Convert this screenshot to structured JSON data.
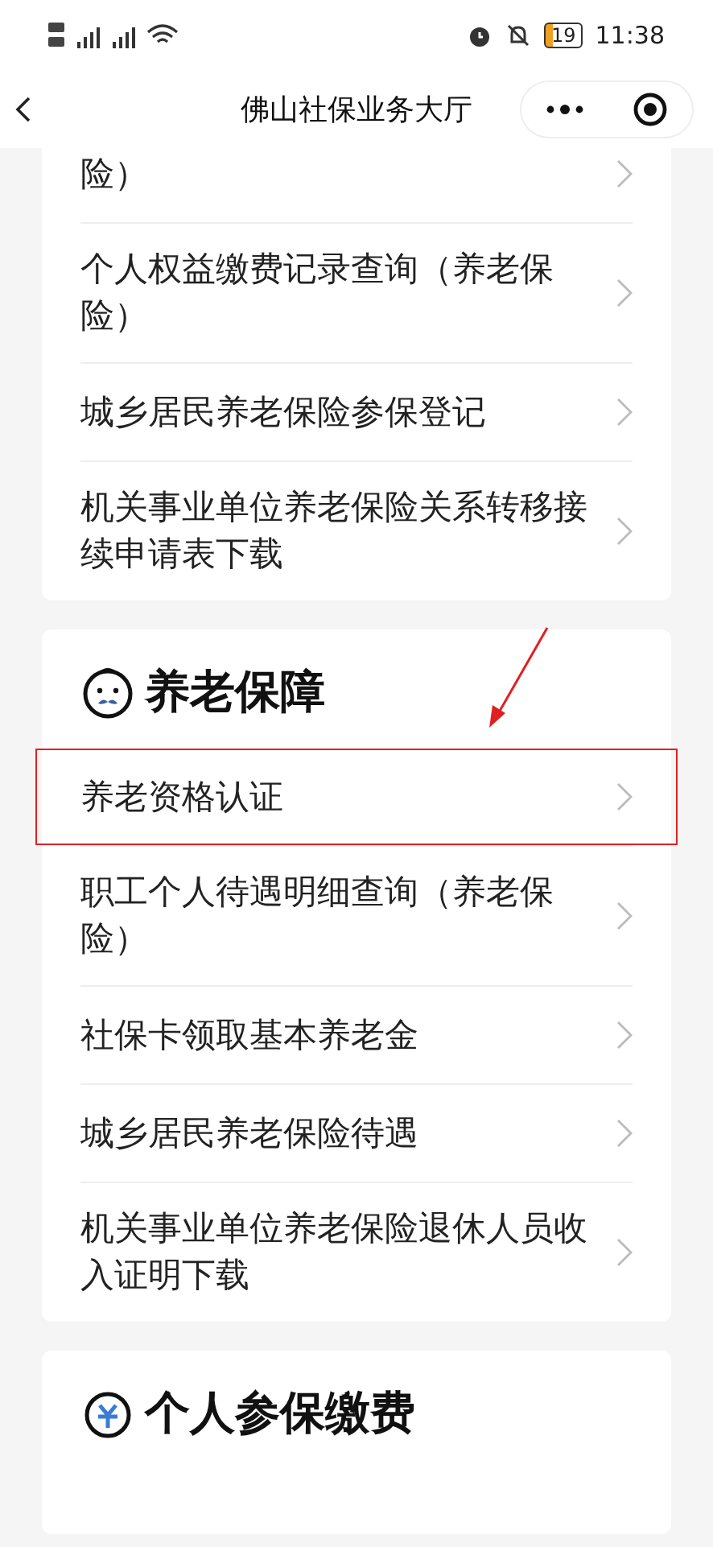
{
  "status_bar": {
    "time": "11:38",
    "battery": "19"
  },
  "nav": {
    "title": "佛山社保业务大厅"
  },
  "sections": [
    {
      "items": [
        {
          "label": "险）",
          "highlighted": false
        },
        {
          "label": "个人权益缴费记录查询（养老保险）",
          "highlighted": false
        },
        {
          "label": "城乡居民养老保险参保登记",
          "highlighted": false
        },
        {
          "label": "机关事业单位养老保险关系转移接续申请表下载",
          "highlighted": false
        }
      ]
    },
    {
      "title": "养老保障",
      "items": [
        {
          "label": "养老资格认证",
          "highlighted": true
        },
        {
          "label": "职工个人待遇明细查询（养老保险）",
          "highlighted": false
        },
        {
          "label": "社保卡领取基本养老金",
          "highlighted": false
        },
        {
          "label": "城乡居民养老保险待遇",
          "highlighted": false
        },
        {
          "label": "机关事业单位养老保险退休人员收入证明下载",
          "highlighted": false
        }
      ]
    },
    {
      "title": "个人参保缴费"
    }
  ]
}
